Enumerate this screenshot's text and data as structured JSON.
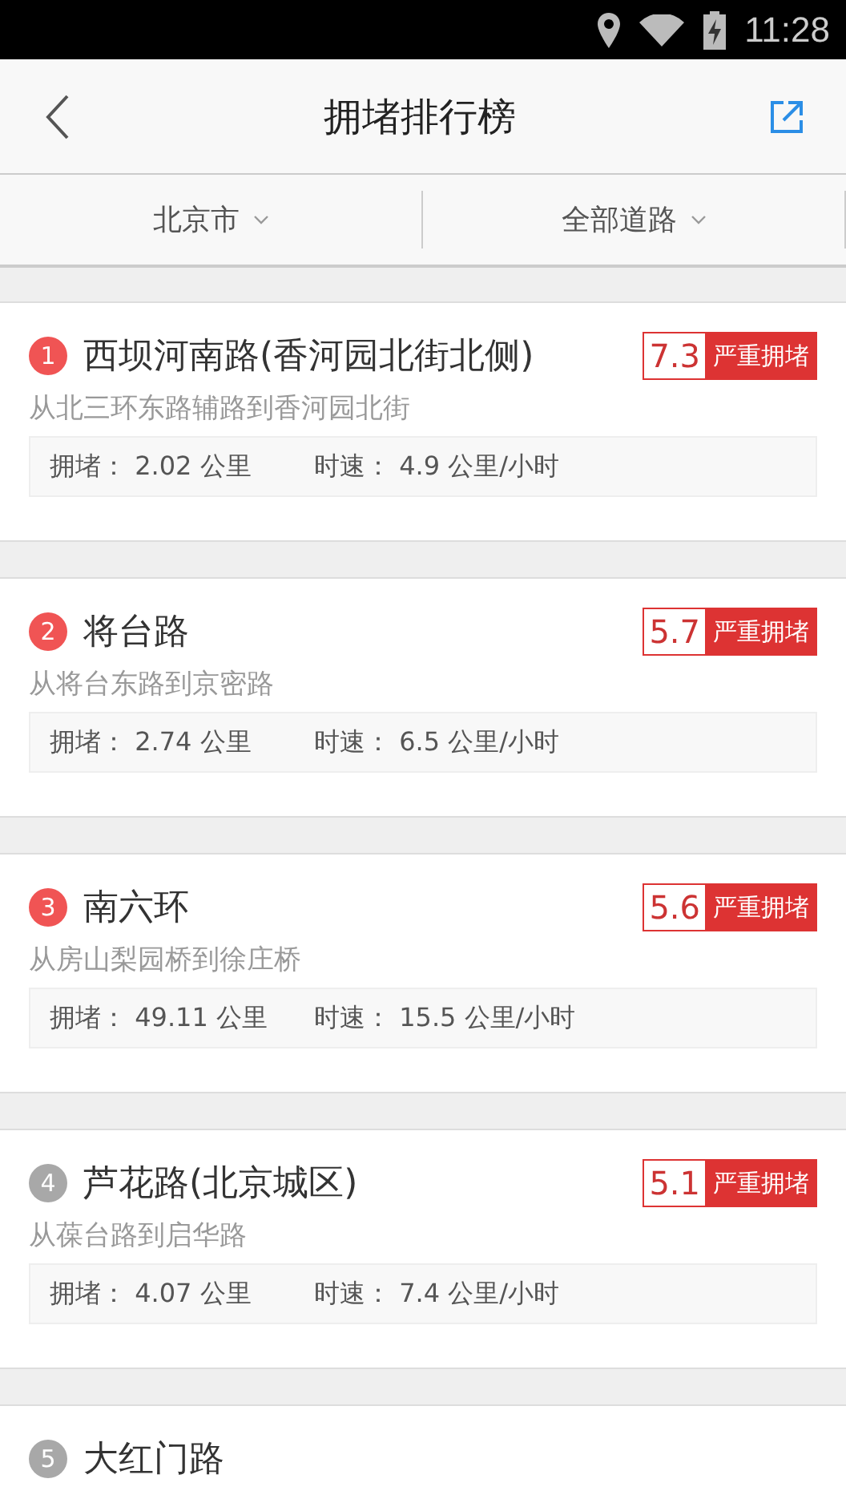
{
  "status_bar": {
    "time": "11:28"
  },
  "header": {
    "title": "拥堵排行榜"
  },
  "filters": [
    {
      "label": "北京市"
    },
    {
      "label": "全部道路"
    }
  ],
  "roads": [
    {
      "rank": "1",
      "color": "#f05454",
      "name": "西坝河南路(香河园北街北侧)",
      "score": "7.3",
      "level_text": "严重拥堵",
      "route": "从北三环东路辅路到香河园北街",
      "jam": "拥堵： 2.02 公里",
      "speed": "时速： 4.9 公里/小时"
    },
    {
      "rank": "2",
      "color": "#f05454",
      "name": "将台路",
      "score": "5.7",
      "level_text": "严重拥堵",
      "route": "从将台东路到京密路",
      "jam": "拥堵： 2.74 公里",
      "speed": "时速： 6.5 公里/小时"
    },
    {
      "rank": "3",
      "color": "#f05454",
      "name": "南六环",
      "score": "5.6",
      "level_text": "严重拥堵",
      "route": "从房山梨园桥到徐庄桥",
      "jam": "拥堵： 49.11 公里",
      "speed": "时速： 15.5 公里/小时"
    },
    {
      "rank": "4",
      "color": "#a8a8a8",
      "name": "芦花路(北京城区)",
      "score": "5.1",
      "level_text": "严重拥堵",
      "route": "从葆台路到启华路",
      "jam": "拥堵： 4.07 公里",
      "speed": "时速： 7.4 公里/小时"
    },
    {
      "rank": "5",
      "color": "#a8a8a8",
      "name": "大红门路"
    }
  ]
}
